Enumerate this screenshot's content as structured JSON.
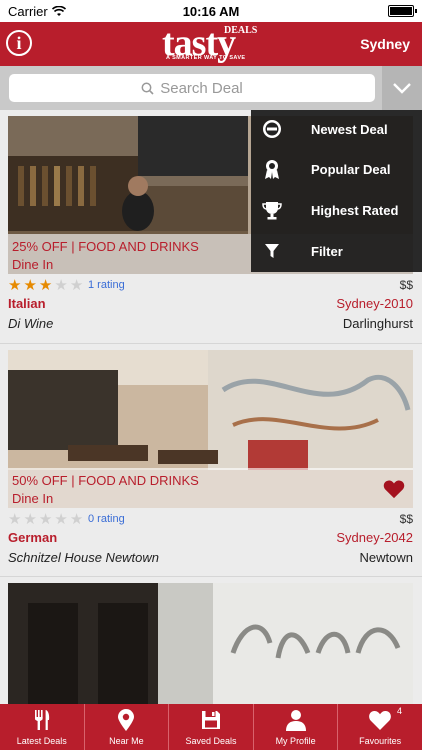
{
  "status_bar": {
    "carrier": "Carrier",
    "time": "10:16 AM"
  },
  "header": {
    "logo_word": "tasty",
    "logo_deals": "DEALS",
    "logo_tagline": "A SMARTER WAY TO SAVE",
    "city": "Sydney",
    "accent": "#b81e2c"
  },
  "search": {
    "placeholder": "Search Deal"
  },
  "menu": {
    "items": [
      {
        "label": "Newest Deal",
        "icon": "new-badge-icon"
      },
      {
        "label": "Popular Deal",
        "icon": "award-ribbon-icon"
      },
      {
        "label": "Highest Rated",
        "icon": "trophy-icon"
      },
      {
        "label": "Filter",
        "icon": "funnel-icon"
      }
    ]
  },
  "deals": [
    {
      "offer": "25% OFF | FOOD AND DRINKS",
      "service": "Dine In",
      "stars": 3,
      "rating": "1 rating",
      "price": "$$",
      "cuisine": "Italian",
      "suburb_code": "Sydney-2010",
      "name": "Di Wine",
      "suburb": "Darlinghurst",
      "favourited": false
    },
    {
      "offer": "50% OFF | FOOD AND DRINKS",
      "service": "Dine In",
      "stars": 0,
      "rating": "0 rating",
      "price": "$$",
      "cuisine": "German",
      "suburb_code": "Sydney-2042",
      "name": "Schnitzel House Newtown",
      "suburb": "Newtown",
      "favourited": true
    }
  ],
  "tabbar": {
    "tabs": [
      {
        "label": "Latest Deals",
        "icon": "fork-knife-icon"
      },
      {
        "label": "Near Me",
        "icon": "location-pin-icon"
      },
      {
        "label": "Saved Deals",
        "icon": "save-disk-icon"
      },
      {
        "label": "My Profile",
        "icon": "person-icon"
      },
      {
        "label": "Favourites",
        "icon": "heart-icon",
        "badge": "4"
      }
    ]
  }
}
